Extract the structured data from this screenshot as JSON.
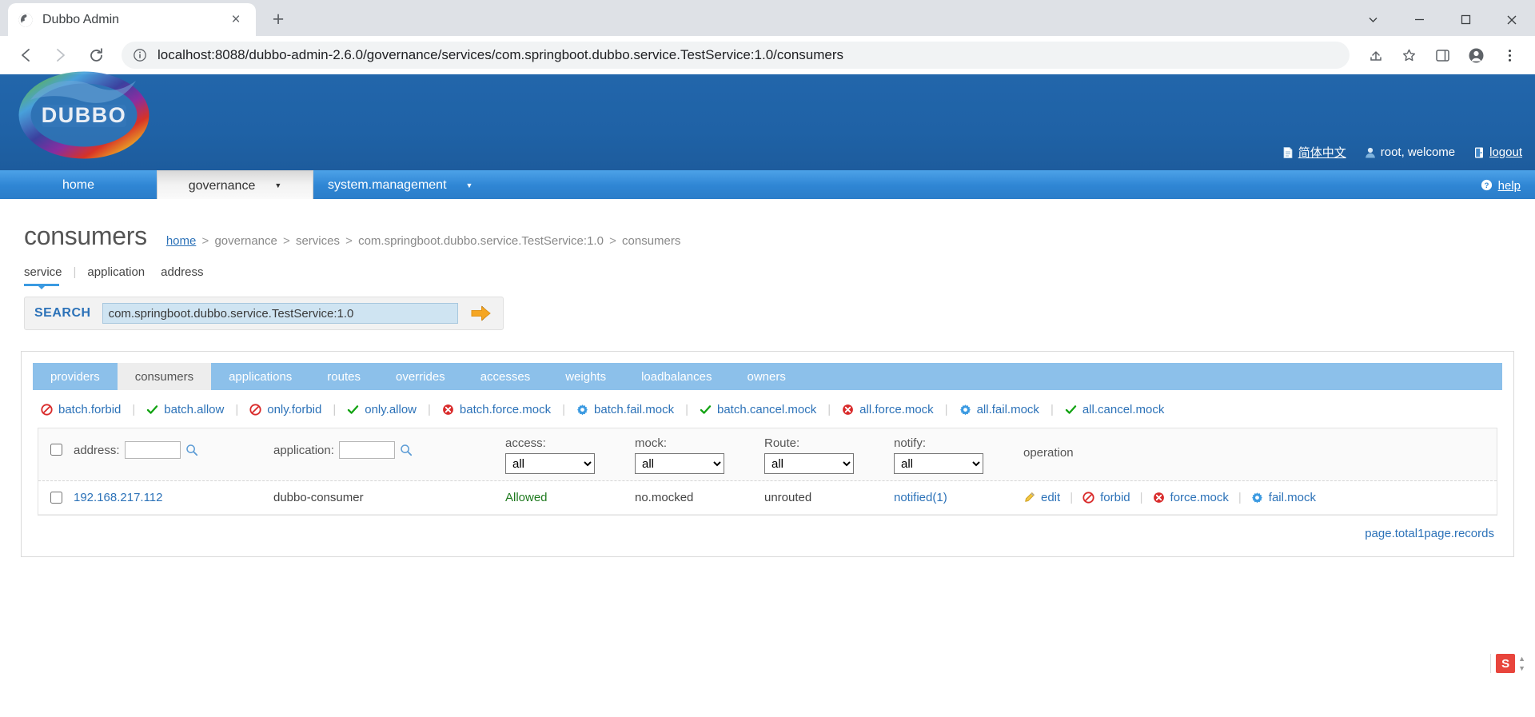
{
  "browser": {
    "tab": {
      "title": "Dubbo Admin",
      "favicon": "globe-icon",
      "close": "×"
    },
    "new_tab_label": "+",
    "url_secure_icon": "info-circle-icon",
    "url": "localhost:8088/dubbo-admin-2.6.0/governance/services/com.springboot.dubbo.service.TestService:1.0/consumers",
    "url_host": "localhost:8088",
    "url_path": "/dubbo-admin-2.6.0/governance/services/com.springboot.dubbo.service.TestService:1.0/consumers",
    "toolbar_icons": [
      "share-icon",
      "star-icon",
      "sidepanel-icon",
      "profile-icon",
      "menu-icon"
    ],
    "window_controls": [
      "chevron-down-icon",
      "minimize-icon",
      "maximize-icon",
      "close-icon"
    ]
  },
  "header": {
    "logo_text": "DUBBO",
    "links": {
      "language": "简体中文",
      "user": "root, welcome",
      "logout": "logout"
    }
  },
  "nav": {
    "items": [
      {
        "label": "home",
        "active": false,
        "caret": false
      },
      {
        "label": "governance",
        "active": true,
        "caret": true
      },
      {
        "label": "system.management",
        "active": false,
        "caret": true
      }
    ],
    "help": "help"
  },
  "page": {
    "title": "consumers",
    "breadcrumb": {
      "home": "home",
      "parts": [
        "governance",
        "services",
        "com.springboot.dubbo.service.TestService:1.0",
        "consumers"
      ],
      "separator": ">"
    },
    "sub_tabs": [
      {
        "label": "service",
        "active": true
      },
      {
        "label": "application",
        "active": false
      },
      {
        "label": "address",
        "active": false
      }
    ],
    "search": {
      "label": "SEARCH",
      "value": "com.springboot.dubbo.service.TestService:1.0",
      "placeholder": "",
      "go_icon": "arrow-right-icon"
    }
  },
  "panel": {
    "tabs": [
      {
        "label": "providers",
        "active": false
      },
      {
        "label": "consumers",
        "active": true
      },
      {
        "label": "applications",
        "active": false
      },
      {
        "label": "routes",
        "active": false
      },
      {
        "label": "overrides",
        "active": false
      },
      {
        "label": "accesses",
        "active": false
      },
      {
        "label": "weights",
        "active": false
      },
      {
        "label": "loadbalances",
        "active": false
      },
      {
        "label": "owners",
        "active": false
      }
    ],
    "batch_actions": [
      {
        "label": "batch.forbid",
        "icon": "forbid-icon"
      },
      {
        "label": "batch.allow",
        "icon": "check-icon"
      },
      {
        "label": "only.forbid",
        "icon": "forbid-icon"
      },
      {
        "label": "only.allow",
        "icon": "check-icon"
      },
      {
        "label": "batch.force.mock",
        "icon": "error-circle-icon"
      },
      {
        "label": "batch.fail.mock",
        "icon": "gear-icon"
      },
      {
        "label": "batch.cancel.mock",
        "icon": "check-icon"
      },
      {
        "label": "all.force.mock",
        "icon": "error-circle-icon"
      },
      {
        "label": "all.fail.mock",
        "icon": "gear-icon"
      },
      {
        "label": "all.cancel.mock",
        "icon": "check-icon"
      }
    ],
    "separator": "|",
    "filters": {
      "address_label": "address:",
      "address_value": "",
      "application_label": "application:",
      "application_value": "",
      "access_label": "access:",
      "access_value": "all",
      "mock_label": "mock:",
      "mock_value": "all",
      "route_label": "Route:",
      "route_value": "all",
      "notify_label": "notify:",
      "notify_value": "all",
      "operation_label": "operation",
      "dropdown_options": [
        "all"
      ],
      "search_icon": "magnifier-icon"
    },
    "rows": [
      {
        "address": "192.168.217.112",
        "application": "dubbo-consumer",
        "access": "Allowed",
        "mock": "no.mocked",
        "route": "unrouted",
        "notify": "notified(1)",
        "operations": [
          {
            "label": "edit",
            "icon": "pencil-icon"
          },
          {
            "label": "forbid",
            "icon": "forbid-icon"
          },
          {
            "label": "force.mock",
            "icon": "error-circle-icon"
          },
          {
            "label": "fail.mock",
            "icon": "gear-icon"
          }
        ]
      }
    ],
    "pager": "page.total1page.records"
  },
  "float_widget": {
    "badge": "S"
  },
  "colors": {
    "header_blue": "#1f62a6",
    "nav_blue": "#2f86d4",
    "tab_blue": "#8cc0ea",
    "link_blue": "#2c72b8",
    "green": "#1f7a1f",
    "red": "#d92b2b",
    "orange": "#f5a623"
  }
}
